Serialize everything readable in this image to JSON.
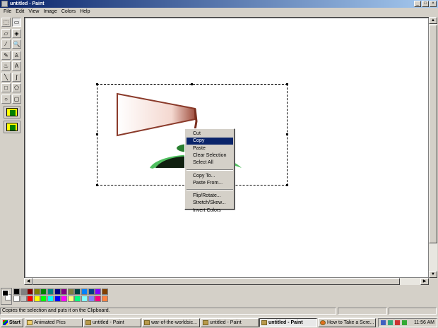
{
  "window": {
    "title": "untitled - Paint",
    "controls": [
      "_",
      "□",
      "×"
    ]
  },
  "menubar": [
    "File",
    "Edit",
    "View",
    "Image",
    "Colors",
    "Help"
  ],
  "toolbox": {
    "tools": [
      {
        "name": "free-form-select-tool",
        "glyph": "⬚"
      },
      {
        "name": "select-tool",
        "glyph": "▭"
      },
      {
        "name": "eraser-tool",
        "glyph": "▱"
      },
      {
        "name": "fill-tool",
        "glyph": "◈"
      },
      {
        "name": "pick-color-tool",
        "glyph": "⁄"
      },
      {
        "name": "magnifier-tool",
        "glyph": "🔍"
      },
      {
        "name": "pencil-tool",
        "glyph": "✎"
      },
      {
        "name": "brush-tool",
        "glyph": "♙"
      },
      {
        "name": "airbrush-tool",
        "glyph": "♨"
      },
      {
        "name": "text-tool",
        "glyph": "A"
      },
      {
        "name": "line-tool",
        "glyph": "╲"
      },
      {
        "name": "curve-tool",
        "glyph": "∫"
      },
      {
        "name": "rectangle-tool",
        "glyph": "□"
      },
      {
        "name": "polygon-tool",
        "glyph": "⬠"
      },
      {
        "name": "ellipse-tool",
        "glyph": "○"
      },
      {
        "name": "rounded-rectangle-tool",
        "glyph": "▢"
      }
    ]
  },
  "context_menu": {
    "items": [
      {
        "label": "Cut",
        "selected": false
      },
      {
        "label": "Copy",
        "selected": true
      },
      {
        "label": "Paste",
        "selected": false
      },
      {
        "label": "Clear Selection",
        "selected": false
      },
      {
        "label": "Select All",
        "selected": false
      },
      {
        "sep": true
      },
      {
        "label": "Copy To...",
        "selected": false
      },
      {
        "label": "Paste From...",
        "selected": false
      },
      {
        "sep": true
      },
      {
        "label": "Flip/Rotate...",
        "selected": false
      },
      {
        "label": "Stretch/Skew...",
        "selected": false
      },
      {
        "label": "Invert Colors",
        "selected": false
      }
    ]
  },
  "palette": {
    "foreground": "#000000",
    "background": "#ffffff",
    "row1": [
      "#000000",
      "#808080",
      "#800000",
      "#808000",
      "#008000",
      "#008080",
      "#000080",
      "#800080",
      "#808040",
      "#004040",
      "#0080ff",
      "#004080",
      "#8000ff",
      "#804000"
    ],
    "row2": [
      "#ffffff",
      "#c0c0c0",
      "#ff0000",
      "#ffff00",
      "#00ff00",
      "#00ffff",
      "#0000ff",
      "#ff00ff",
      "#ffff80",
      "#00ff80",
      "#80ffff",
      "#8080ff",
      "#ff0080",
      "#ff8040"
    ]
  },
  "status": {
    "text": "Copies the selection and puts it on the Clipboard."
  },
  "taskbar": {
    "start": "Start",
    "tasks": [
      {
        "label": "Animated Pics",
        "icon": "folder",
        "active": false
      },
      {
        "label": "untitled - Paint",
        "icon": "paint",
        "active": false
      },
      {
        "label": "war-of-the-worldsic...",
        "icon": "paint",
        "active": false
      },
      {
        "label": "untitled - Paint",
        "icon": "paint",
        "active": false
      },
      {
        "label": "untitled - Paint",
        "icon": "paint",
        "active": true
      },
      {
        "label": "How to Take a Scre...",
        "icon": "firefox",
        "active": false
      }
    ],
    "clock": "11:56 AM"
  }
}
